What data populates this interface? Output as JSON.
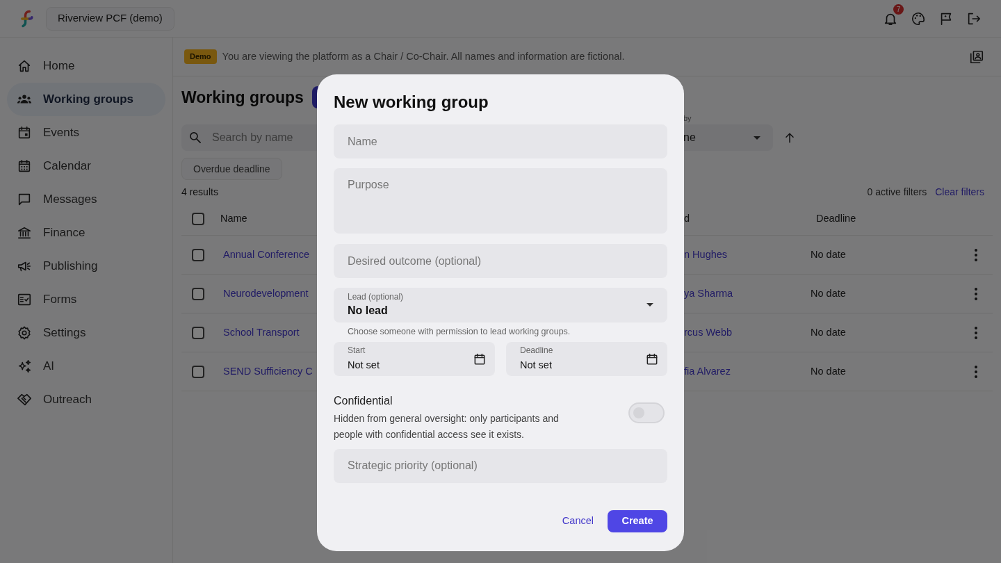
{
  "topbar": {
    "workspace": "Riverview PCF (demo)",
    "notifications": "7"
  },
  "sidebar": {
    "items": [
      {
        "label": "Home",
        "kind": "home",
        "selected": false
      },
      {
        "label": "Working groups",
        "kind": "people",
        "selected": true
      },
      {
        "label": "Events",
        "kind": "event",
        "selected": false
      },
      {
        "label": "Calendar",
        "kind": "calendar",
        "selected": false
      },
      {
        "label": "Messages",
        "kind": "message",
        "selected": false
      },
      {
        "label": "Finance",
        "kind": "bank",
        "selected": false
      },
      {
        "label": "Publishing",
        "kind": "megaphone",
        "selected": false
      },
      {
        "label": "Forms",
        "kind": "form",
        "selected": false
      },
      {
        "label": "Settings",
        "kind": "gear",
        "selected": false
      },
      {
        "label": "AI",
        "kind": "sparkle",
        "selected": false
      },
      {
        "label": "Outreach",
        "kind": "handshake",
        "selected": false
      }
    ]
  },
  "banner": {
    "badge": "Demo",
    "text": "You are viewing the platform as a Chair / Co-Chair. All names and information are fictional."
  },
  "page": {
    "title": "Working groups",
    "search_placeholder": "Search by name",
    "filter_chip": "Overdue deadline",
    "results": "4 results",
    "sort_label": "by",
    "sort_value": "ne",
    "active_filters": "0 active filters",
    "clear_filters": "Clear filters"
  },
  "table": {
    "select_all_checked": false,
    "columns": [
      "Name",
      "d",
      "Deadline"
    ],
    "rows": [
      {
        "checked": false,
        "name": "Annual Conference",
        "lead": "n Hughes",
        "deadline": "No date"
      },
      {
        "checked": false,
        "name": "Neurodevelopment",
        "lead": "ya Sharma",
        "deadline": "No date"
      },
      {
        "checked": false,
        "name": "School Transport",
        "lead": "rcus Webb",
        "deadline": "No date"
      },
      {
        "checked": false,
        "name": "SEND Sufficiency C",
        "lead": "fia Alvarez",
        "deadline": "No date"
      }
    ]
  },
  "dialog": {
    "title": "New working group",
    "name_placeholder": "Name",
    "purpose_placeholder": "Purpose",
    "outcome_placeholder": "Desired outcome (optional)",
    "lead_label": "Lead (optional)",
    "lead_value": "No lead",
    "lead_help": "Choose someone with permission to lead working groups.",
    "start_label": "Start",
    "start_value": "Not set",
    "deadline_label": "Deadline",
    "deadline_value": "Not set",
    "confidential_title": "Confidential",
    "confidential_text": "Hidden from general oversight: only participants and people with confidential access see it exists.",
    "confidential_on": false,
    "priority_placeholder": "Strategic priority (optional)",
    "cancel": "Cancel",
    "create": "Create"
  }
}
